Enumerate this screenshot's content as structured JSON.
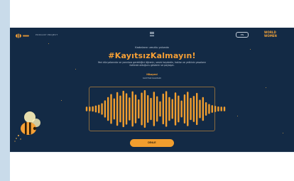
{
  "header": {
    "nav_text": "PODCAST PROJECT",
    "lang_label": "EN",
    "brand_right_1": "WORLD",
    "brand_right_2": "WOMEN"
  },
  "hero": {
    "kicker": "Kadınların umutlu yolunda",
    "hashtag": "#KayıtsızKalmayın!",
    "description": "Yeni dünyalarında ve yarınlara gerektiğini öğrenin, sesini kaydedin, haklar ve yetkinin yasaların üstünde olduğunu gösterin ve paylaşın.",
    "listen_label": "Hikayeni",
    "listen_sub": "KAYITSIZ KALMADI"
  },
  "player": {
    "play_label": "DİNLE",
    "wave_levels": [
      0.12,
      0.12,
      0.14,
      0.18,
      0.22,
      0.3,
      0.45,
      0.62,
      0.78,
      0.55,
      0.88,
      0.7,
      0.95,
      0.82,
      0.6,
      0.92,
      0.75,
      0.5,
      0.85,
      0.98,
      0.72,
      0.58,
      0.9,
      0.66,
      0.4,
      0.8,
      0.93,
      0.62,
      0.52,
      0.86,
      0.7,
      0.44,
      0.76,
      0.9,
      0.58,
      0.68,
      0.84,
      0.48,
      0.62,
      0.35,
      0.26,
      0.2,
      0.16,
      0.13,
      0.12,
      0.12
    ],
    "wave_color": "#f29e2e"
  },
  "colors": {
    "background": "#132a45",
    "accent": "#f6a035"
  },
  "icons": {
    "menu": "menu-icon",
    "logo": "bee-logo-icon",
    "mascot": "bee-mascot-icon"
  }
}
